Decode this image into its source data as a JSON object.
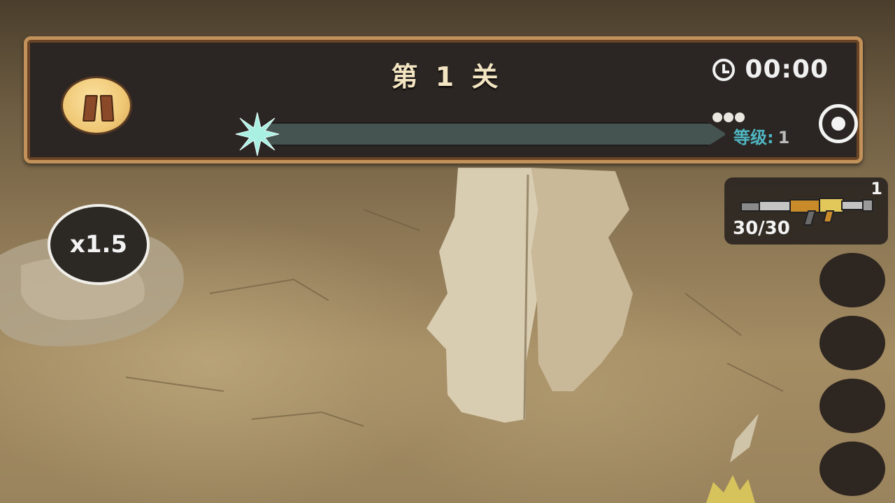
{
  "hud": {
    "level_title": "第 1 关",
    "timer": "00:00",
    "xp_progress": 0.0,
    "level_label": "等级:",
    "level_value": "1",
    "speed_multiplier": "x1.5"
  },
  "weapon": {
    "slot_number": "1",
    "ammo": "30/30",
    "icon": "assault-rifle-icon"
  },
  "icons": {
    "pause": "pause-icon",
    "clock": "clock-icon",
    "spark": "spark-icon",
    "dots": "dots-icon",
    "target": "target-icon"
  },
  "colors": {
    "panel_bg": "#2b2623",
    "panel_border": "#c2925a",
    "xp_bar": "#465451",
    "level_label": "#4fb7c2",
    "text": "#f0f0f0"
  },
  "skill_slots": [
    {
      "state": "empty"
    },
    {
      "state": "empty"
    },
    {
      "state": "empty"
    },
    {
      "state": "empty"
    }
  ]
}
